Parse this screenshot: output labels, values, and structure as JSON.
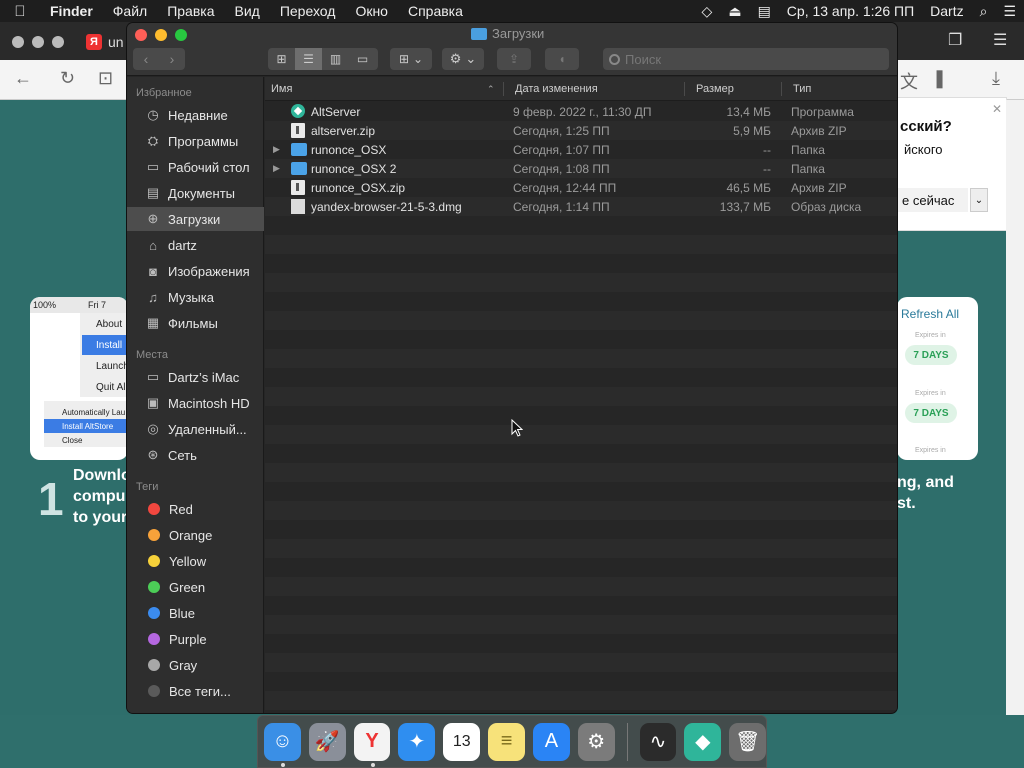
{
  "menubar": {
    "app_name": "Finder",
    "items": [
      "Файл",
      "Правка",
      "Вид",
      "Переход",
      "Окно",
      "Справка"
    ],
    "clock": "Ср, 13 апр.  1:26 ПП",
    "user": "Dartz"
  },
  "browser": {
    "tab_text": "un",
    "popup": {
      "title": "сский?",
      "subtitle": "йского",
      "button": "е сейчас"
    },
    "card_left": {
      "status": "100%",
      "menu_top": "Fri 7",
      "menu_items": [
        "About",
        "Install",
        "Launch",
        "Quit Al"
      ],
      "submenu_items": [
        "Automatically Lau",
        "Install AltStore",
        "Close"
      ]
    },
    "step_number": "1",
    "step_text": [
      "Downlo",
      "compu",
      "to your"
    ],
    "right_text": [
      "ng, and",
      "st."
    ],
    "card_right": {
      "title": "Refresh All",
      "expires": "Expires in",
      "badges": [
        "7 DAYS",
        "7 DAYS"
      ]
    }
  },
  "finder": {
    "title": "Загрузки",
    "search_placeholder": "Поиск",
    "sidebar": {
      "favorites_header": "Избранное",
      "favorites": [
        {
          "label": "Недавние",
          "icon": "clock-icon"
        },
        {
          "label": "Программы",
          "icon": "applications-icon"
        },
        {
          "label": "Рабочий стол",
          "icon": "desktop-icon"
        },
        {
          "label": "Документы",
          "icon": "documents-icon"
        },
        {
          "label": "Загрузки",
          "icon": "downloads-icon",
          "selected": true
        },
        {
          "label": "dartz",
          "icon": "home-icon"
        },
        {
          "label": "Изображения",
          "icon": "camera-icon"
        },
        {
          "label": "Музыка",
          "icon": "music-icon"
        },
        {
          "label": "Фильмы",
          "icon": "film-icon"
        }
      ],
      "locations_header": "Места",
      "locations": [
        {
          "label": "Dartz’s iMac",
          "icon": "imac-icon"
        },
        {
          "label": "Macintosh HD",
          "icon": "disk-icon"
        },
        {
          "label": "Удаленный...",
          "icon": "remote-disc-icon"
        },
        {
          "label": "Сеть",
          "icon": "network-icon"
        }
      ],
      "tags_header": "Теги",
      "tags": [
        {
          "label": "Red",
          "color": "#f2473f"
        },
        {
          "label": "Orange",
          "color": "#f7a23a"
        },
        {
          "label": "Yellow",
          "color": "#f6d13a"
        },
        {
          "label": "Green",
          "color": "#4ccd57"
        },
        {
          "label": "Blue",
          "color": "#3b8cf0"
        },
        {
          "label": "Purple",
          "color": "#b567e0"
        },
        {
          "label": "Gray",
          "color": "#a8a8a8"
        },
        {
          "label": "Все теги...",
          "color": "#5a5a5a"
        }
      ]
    },
    "columns": {
      "name": "Имя",
      "date": "Дата изменения",
      "size": "Размер",
      "type": "Тип"
    },
    "files": [
      {
        "name": "AltServer",
        "date": "9 февр. 2022 г., 11:30 ДП",
        "size": "13,4 МБ",
        "type": "Программа",
        "icon": "app",
        "folder": false
      },
      {
        "name": "altserver.zip",
        "date": "Сегодня, 1:25 ПП",
        "size": "5,9 МБ",
        "type": "Архив ZIP",
        "icon": "doc",
        "folder": false
      },
      {
        "name": "runonce_OSX",
        "date": "Сегодня, 1:07 ПП",
        "size": "--",
        "type": "Папка",
        "icon": "folder",
        "folder": true
      },
      {
        "name": "runonce_OSX 2",
        "date": "Сегодня, 1:08 ПП",
        "size": "--",
        "type": "Папка",
        "icon": "folder",
        "folder": true
      },
      {
        "name": "runonce_OSX.zip",
        "date": "Сегодня, 12:44 ПП",
        "size": "46,5 МБ",
        "type": "Архив ZIP",
        "icon": "doc",
        "folder": false
      },
      {
        "name": "yandex-browser-21-5-3.dmg",
        "date": "Сегодня, 1:14 ПП",
        "size": "133,7 МБ",
        "type": "Образ диска",
        "icon": "dmg",
        "folder": false
      }
    ]
  },
  "dock": {
    "apps": [
      {
        "name": "finder-icon",
        "color": "#3a8fe6",
        "glyph": "☺"
      },
      {
        "name": "launchpad-icon",
        "color": "#8a8f99",
        "glyph": "🚀"
      },
      {
        "name": "yandex-browser-icon",
        "color": "#f3f3f3",
        "glyph": "Y"
      },
      {
        "name": "safari-icon",
        "color": "#2f8ef0",
        "glyph": "✦"
      },
      {
        "name": "calendar-icon",
        "color": "#ffffff",
        "glyph": "13"
      },
      {
        "name": "notes-icon",
        "color": "#f7e27a",
        "glyph": "≡"
      },
      {
        "name": "app-store-icon",
        "color": "#2a84f5",
        "glyph": "A"
      },
      {
        "name": "system-preferences-icon",
        "color": "#7b7b7b",
        "glyph": "⚙"
      },
      {
        "name": "activity-monitor-icon",
        "color": "#2b2b2b",
        "glyph": "∿"
      },
      {
        "name": "altserver-icon",
        "color": "#2fb59a",
        "glyph": "◆"
      },
      {
        "name": "trash-icon",
        "color": "#6d6d6d",
        "glyph": "🗑"
      }
    ]
  }
}
